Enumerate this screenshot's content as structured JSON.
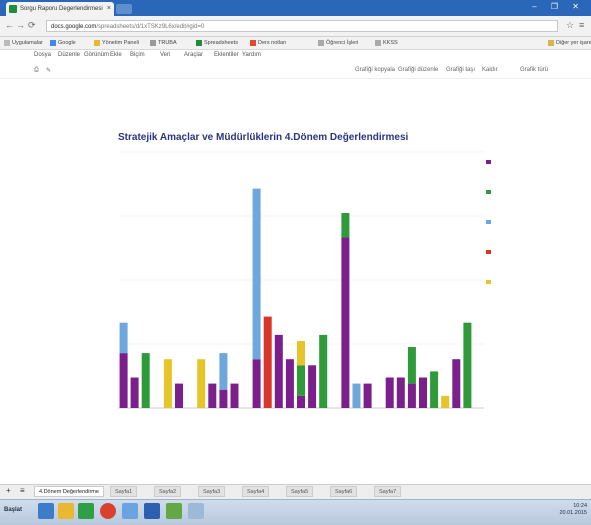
{
  "browser": {
    "tab_title": "Sorgu Raporu Degerlendirmesi",
    "close_glyph": "×",
    "url_host": "docs.google.com",
    "url_path": "/spreadsheets/d/1xTSKz9L6x/edit#gid=0",
    "window_controls": "– ❐ ✕",
    "bookmarks": [
      "Uygulamalar",
      "Google",
      "Yönetim Paneli",
      "TRUBA",
      "Spreadsheets",
      "Ders notları",
      "Öğrenci İşleri",
      "KKSS",
      "Diğer yer işaretleri"
    ]
  },
  "sheets": {
    "menus": [
      "Dosya",
      "Düzenle",
      "Görünüm",
      "Ekle",
      "Biçim",
      "Veri",
      "Araçlar",
      "Eklentiler",
      "Yardım"
    ],
    "toolbar_right": [
      "Grafiği kopyala",
      "Grafiği düzenle",
      "Grafiği taşı",
      "Kaldır",
      "Grafik türü"
    ]
  },
  "chart_data": {
    "type": "bar",
    "stacked": true,
    "title": "Stratejik Amaçlar ve Müdürlüklerin 4.Dönem Değerlendirmesi",
    "categories": [
      "",
      "",
      "",
      "",
      "",
      "",
      "",
      "",
      "",
      "",
      "",
      "",
      "",
      "",
      "",
      "",
      "",
      "",
      "",
      "",
      "",
      "",
      "",
      "",
      "",
      "",
      "",
      "",
      "",
      "",
      "",
      "",
      ""
    ],
    "series": [
      {
        "name": "",
        "color": "#7b1f8c",
        "values": [
          9,
          5,
          0,
          0,
          0,
          4,
          0,
          0,
          4,
          3,
          4,
          0,
          8,
          0,
          12,
          8,
          2,
          7,
          0,
          0,
          28,
          0,
          4,
          0,
          5,
          5,
          4,
          5,
          0,
          0,
          8,
          0,
          0
        ]
      },
      {
        "name": "",
        "color": "#2e9a3a",
        "values": [
          0,
          0,
          9,
          0,
          0,
          0,
          0,
          0,
          0,
          0,
          0,
          0,
          0,
          0,
          0,
          0,
          5,
          0,
          12,
          0,
          4,
          0,
          0,
          0,
          0,
          0,
          6,
          0,
          6,
          0,
          0,
          14,
          0
        ]
      },
      {
        "name": "",
        "color": "#6ea7dc",
        "values": [
          5,
          0,
          0,
          0,
          0,
          0,
          0,
          0,
          0,
          6,
          0,
          0,
          28,
          0,
          0,
          0,
          0,
          0,
          0,
          0,
          0,
          4,
          0,
          0,
          0,
          0,
          0,
          0,
          0,
          0,
          0,
          0,
          0
        ]
      },
      {
        "name": "",
        "color": "#d8352b",
        "values": [
          0,
          0,
          0,
          0,
          0,
          0,
          0,
          0,
          0,
          0,
          0,
          0,
          0,
          15,
          0,
          0,
          0,
          0,
          0,
          0,
          0,
          0,
          0,
          0,
          0,
          0,
          0,
          0,
          0,
          0,
          0,
          0,
          0
        ]
      },
      {
        "name": "",
        "color": "#e6c52a",
        "values": [
          0,
          0,
          0,
          0,
          8,
          0,
          0,
          8,
          0,
          0,
          0,
          0,
          0,
          0,
          0,
          0,
          4,
          0,
          0,
          0,
          0,
          0,
          0,
          0,
          0,
          0,
          0,
          0,
          0,
          2,
          0,
          0,
          0
        ]
      }
    ],
    "legend_position": "right",
    "grid": true
  },
  "bottom": {
    "sheet_tabs": [
      "4.Dönem Değerlendirme",
      "Sayfa1",
      "Sayfa2",
      "Sayfa3",
      "Sayfa4",
      "Sayfa5",
      "Sayfa6",
      "Sayfa7"
    ],
    "add_glyph": "+",
    "start_label": "Başlat",
    "tray_time": "10:24",
    "tray_date": "20.01.2015"
  }
}
